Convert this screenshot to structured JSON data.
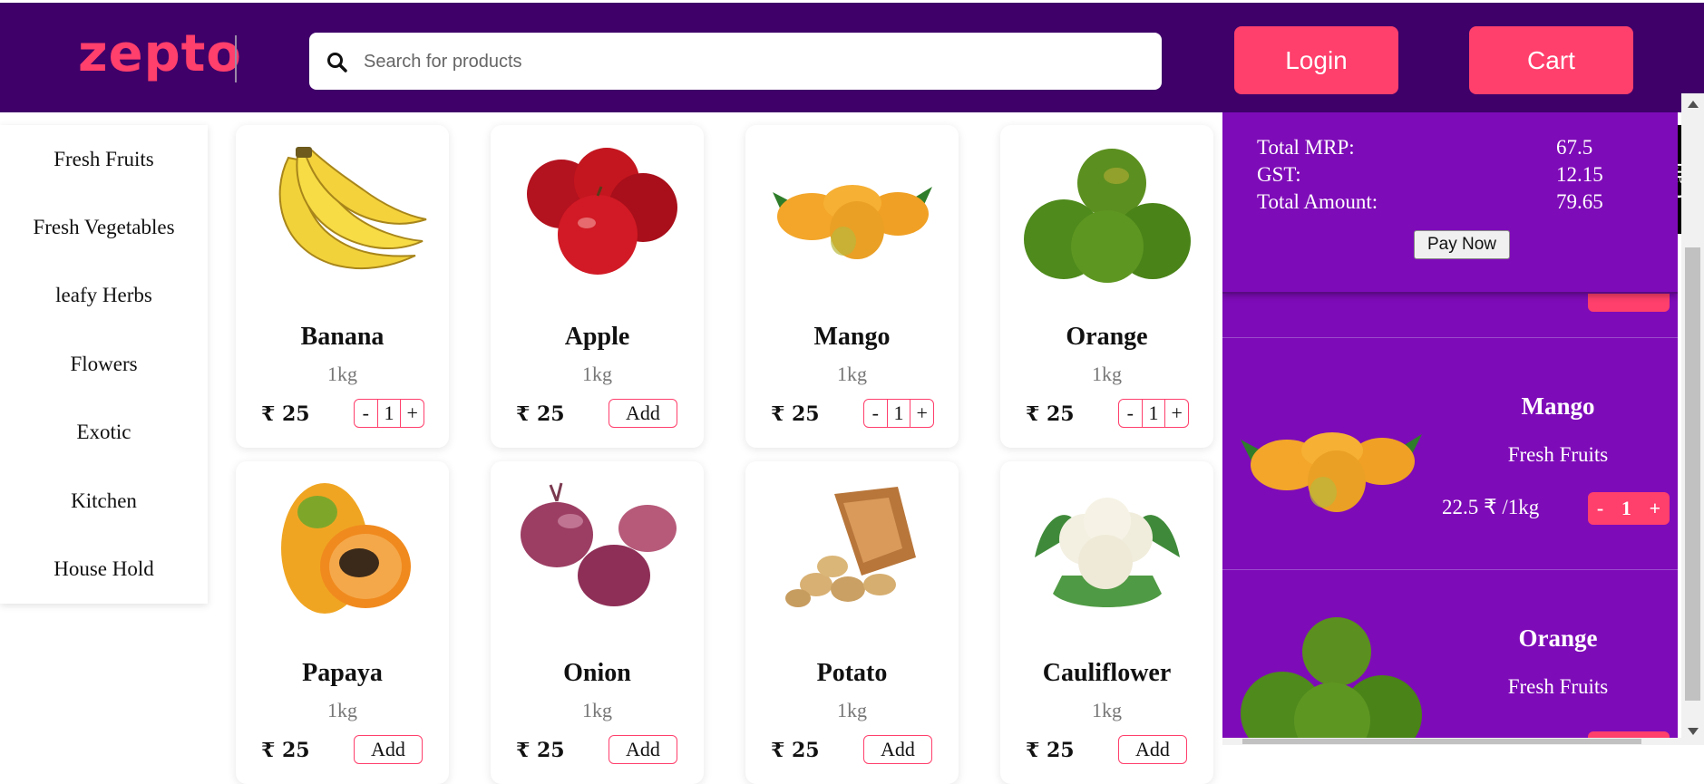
{
  "header": {
    "logo": "zepto",
    "search_placeholder": "Search for products",
    "login_label": "Login",
    "cart_label": "Cart"
  },
  "sidebar": {
    "items": [
      "Fresh Fruits",
      "Fresh Vegetables",
      "leafy Herbs",
      "Flowers",
      "Exotic",
      "Kitchen",
      "House Hold"
    ]
  },
  "products": [
    {
      "name": "Banana",
      "weight": "1kg",
      "price": "₹ 25",
      "qty": "1",
      "control": "stepper"
    },
    {
      "name": "Apple",
      "weight": "1kg",
      "price": "₹ 25",
      "add_label": "Add",
      "control": "add"
    },
    {
      "name": "Mango",
      "weight": "1kg",
      "price": "₹ 25",
      "qty": "1",
      "control": "stepper"
    },
    {
      "name": "Orange",
      "weight": "1kg",
      "price": "₹ 25",
      "qty": "1",
      "control": "stepper"
    },
    {
      "name": "Papaya",
      "weight": "1kg",
      "price": "₹ 25",
      "add_label": "Add",
      "control": "add"
    },
    {
      "name": "Onion",
      "weight": "1kg",
      "price": "₹ 25",
      "add_label": "Add",
      "control": "add"
    },
    {
      "name": "Potato",
      "weight": "1kg",
      "price": "₹ 25",
      "add_label": "Add",
      "control": "add"
    },
    {
      "name": "Cauliflower",
      "weight": "1kg",
      "price": "₹ 25",
      "add_label": "Add",
      "control": "add"
    }
  ],
  "stepper": {
    "minus": "-",
    "plus": "+"
  },
  "cart_panel": {
    "summary": {
      "total_mrp_label": "Total MRP:",
      "total_mrp": "67.5",
      "gst_label": "GST:",
      "gst": "12.15",
      "total_amount_label": "Total Amount:",
      "total_amount": "79.65",
      "pay_now": "Pay Now"
    },
    "items": [
      {
        "name": "Mango",
        "category": "Fresh Fruits",
        "price": "22.5 ₹ /1kg",
        "qty": "1"
      },
      {
        "name": "Orange",
        "category": "Fresh Fruits"
      }
    ],
    "tab_label": "Cart"
  },
  "colors": {
    "header_bg": "#3f0069",
    "accent": "#ff3f6c",
    "panel_bg": "#7e0bb8"
  }
}
